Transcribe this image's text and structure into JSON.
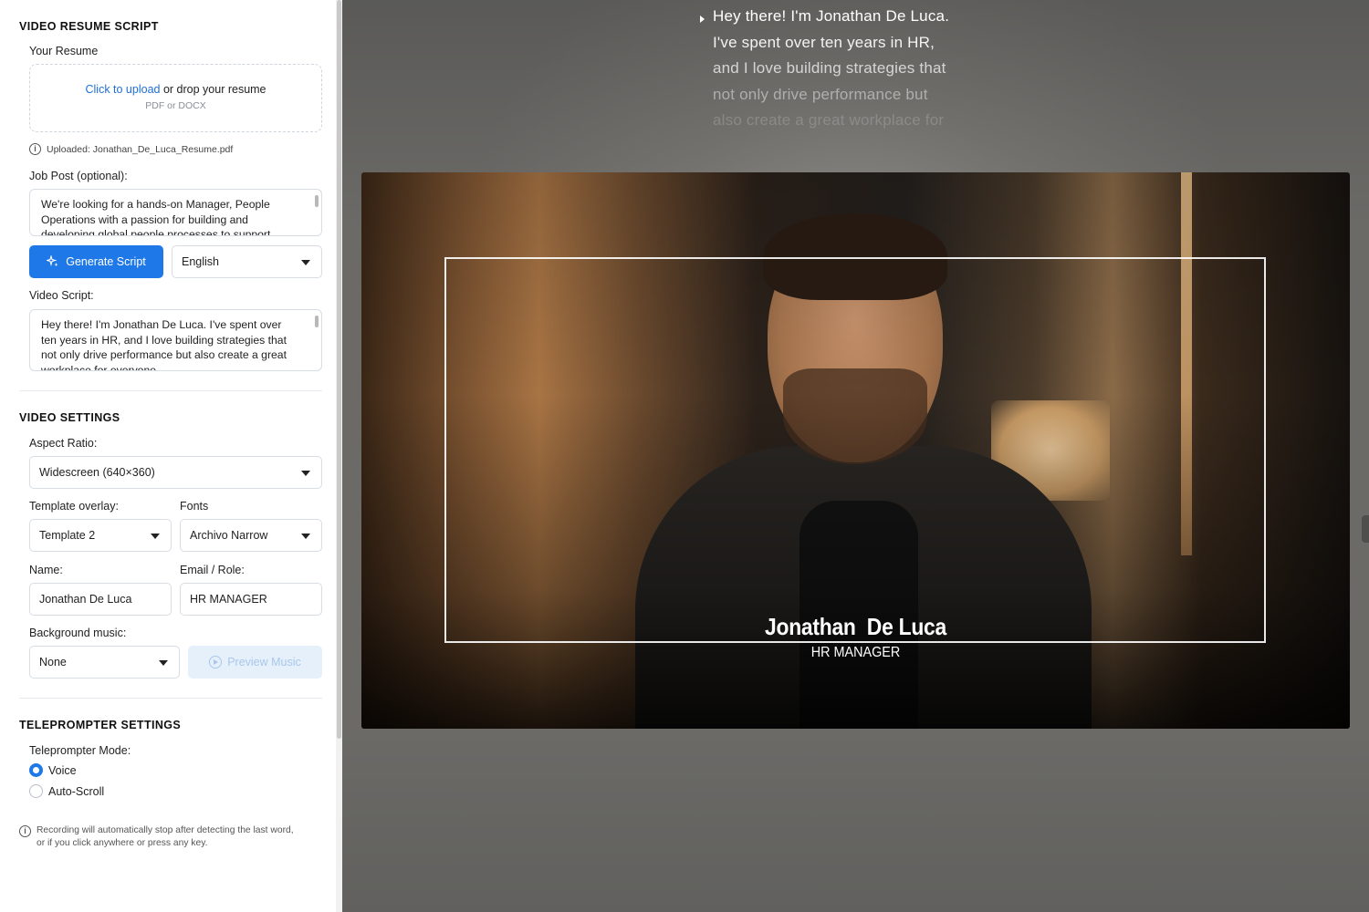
{
  "sidebar": {
    "video_resume_title": "VIDEO RESUME SCRIPT",
    "your_resume_label": "Your Resume",
    "dropzone": {
      "link_text": "Click to upload",
      "rest_text": " or drop your resume",
      "hint": "PDF or DOCX"
    },
    "uploaded_text": "Uploaded: Jonathan_De_Luca_Resume.pdf",
    "job_post_label": "Job Post (optional):",
    "job_post_text": "We're looking for a hands-on Manager, People Operations with a passion for building and developing global people processes to support",
    "generate_button": "Generate Script",
    "language_select": "English",
    "video_script_label": "Video Script:",
    "video_script_text": "Hey there! I'm Jonathan De Luca. I've spent over ten years in HR, and I love building strategies that not only drive performance but also create a great workplace for everyone.",
    "video_settings_title": "VIDEO SETTINGS",
    "aspect_ratio_label": "Aspect Ratio:",
    "aspect_ratio_value": "Widescreen (640×360)",
    "template_label": "Template overlay:",
    "template_value": "Template 2",
    "fonts_label": "Fonts",
    "fonts_value": "Archivo Narrow",
    "name_label": "Name:",
    "name_value": "Jonathan De Luca",
    "email_role_label": "Email / Role:",
    "email_role_value": "HR MANAGER",
    "bg_music_label": "Background music:",
    "bg_music_value": "None",
    "preview_music_button": "Preview Music",
    "teleprompter_title": "TELEPROMPTER SETTINGS",
    "teleprompter_mode_label": "Teleprompter Mode:",
    "modes": [
      {
        "label": "Voice",
        "selected": true
      },
      {
        "label": "Auto-Scroll",
        "selected": false
      }
    ],
    "note_line1": "Recording will automatically stop after detecting the last word,",
    "note_line2": "or if you click anywhere or press any key."
  },
  "teleprompter": {
    "lines": [
      {
        "text": "Hey there! I'm Jonathan De Luca.",
        "opacity": 1.0
      },
      {
        "text": "I've spent over ten years in HR,",
        "opacity": 0.92
      },
      {
        "text": "and I love building strategies that",
        "opacity": 0.72
      },
      {
        "text": "not only drive performance but",
        "opacity": 0.45
      },
      {
        "text": "also create a great workplace for",
        "opacity": 0.18
      }
    ]
  },
  "overlay": {
    "name": "Jonathan  De Luca",
    "role": "HR MANAGER"
  },
  "colors": {
    "accent": "#1e78e8",
    "link": "#1f6fd6"
  }
}
